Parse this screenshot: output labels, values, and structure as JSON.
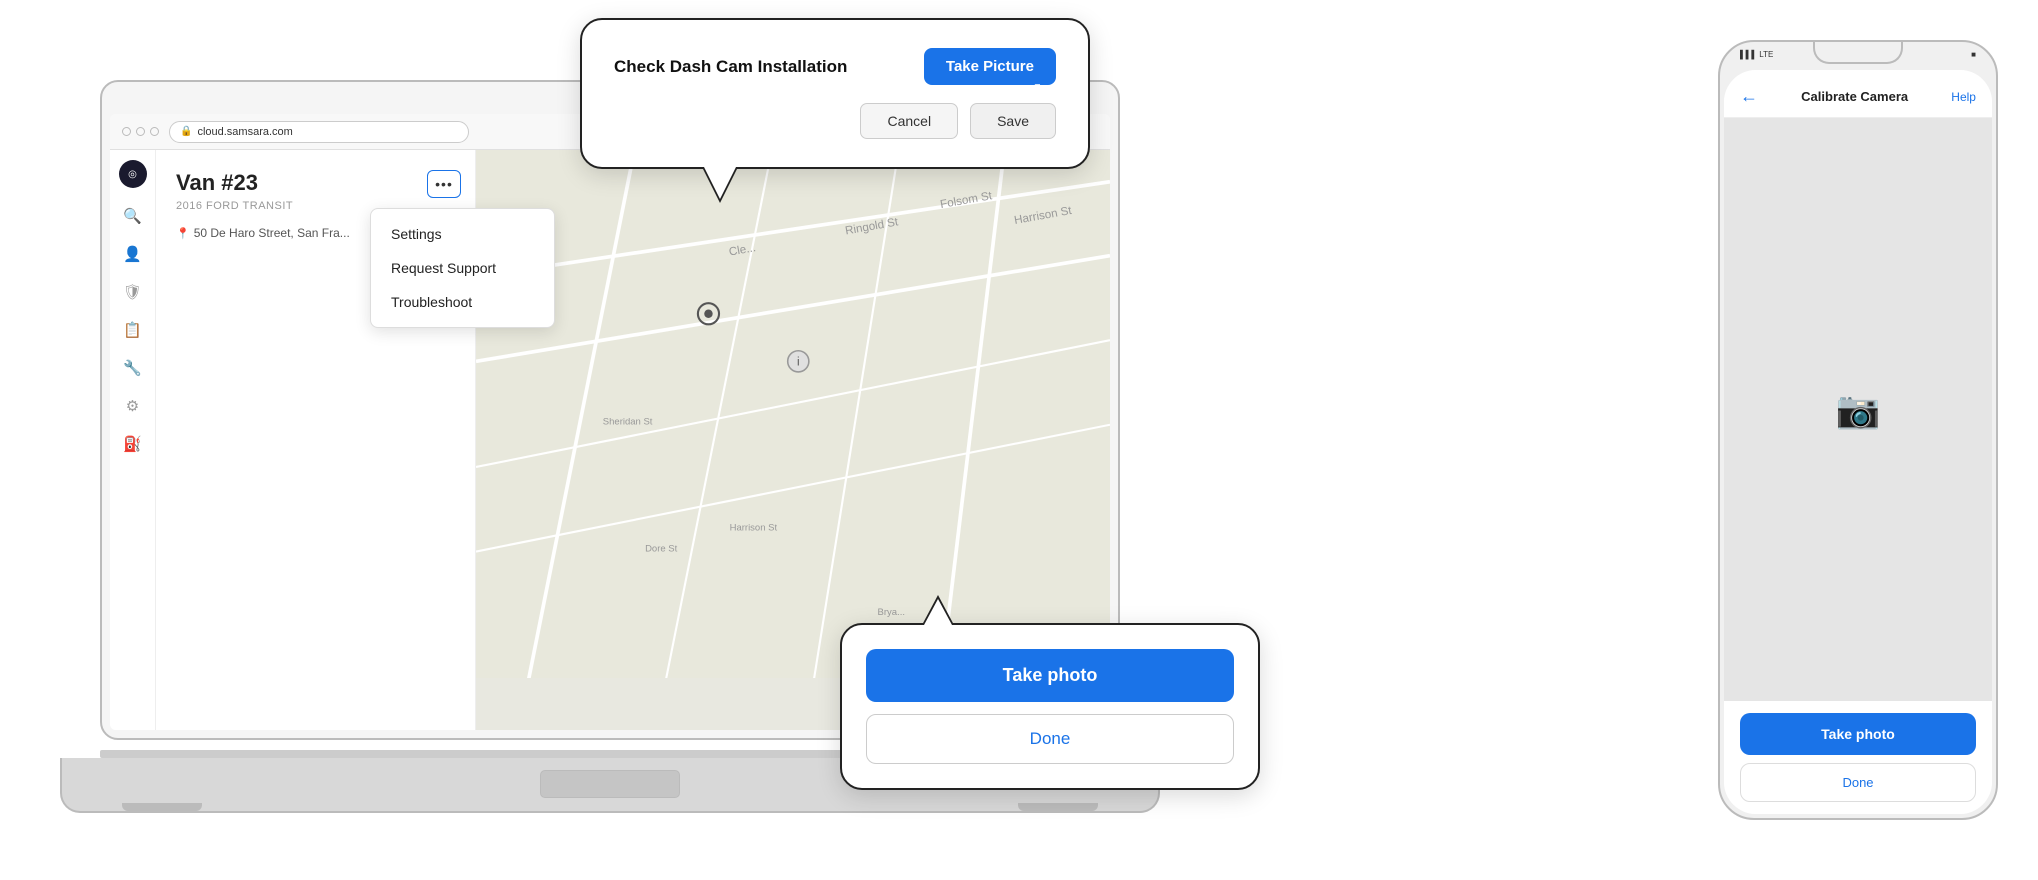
{
  "browser": {
    "url": "cloud.samsara.com"
  },
  "sidebar": {
    "icons": [
      "🦉",
      "🔍",
      "👤",
      "🛡",
      "📋",
      "🔧",
      "⚙",
      "⛽"
    ]
  },
  "vehicle": {
    "name": "Van #23",
    "model": "2016 FORD TRANSIT",
    "address": "50 De Haro Street, San Fra..."
  },
  "dropdown": {
    "items": [
      "Settings",
      "Request Support",
      "Troubleshoot"
    ]
  },
  "popup_dashcam": {
    "title": "Check Dash Cam Installation",
    "take_picture_label": "Take Picture",
    "cancel_label": "Cancel",
    "save_label": "Save"
  },
  "popup_takephoto": {
    "take_photo_label": "Take photo",
    "done_label": "Done"
  },
  "phone": {
    "status": {
      "signal": "▌▌▌ LTE ■",
      "battery": "■"
    },
    "header": {
      "back": "←",
      "title": "Calibrate Camera",
      "help": "Help"
    },
    "take_photo_label": "Take photo",
    "done_label": "Done"
  },
  "three_dots_label": "•••"
}
